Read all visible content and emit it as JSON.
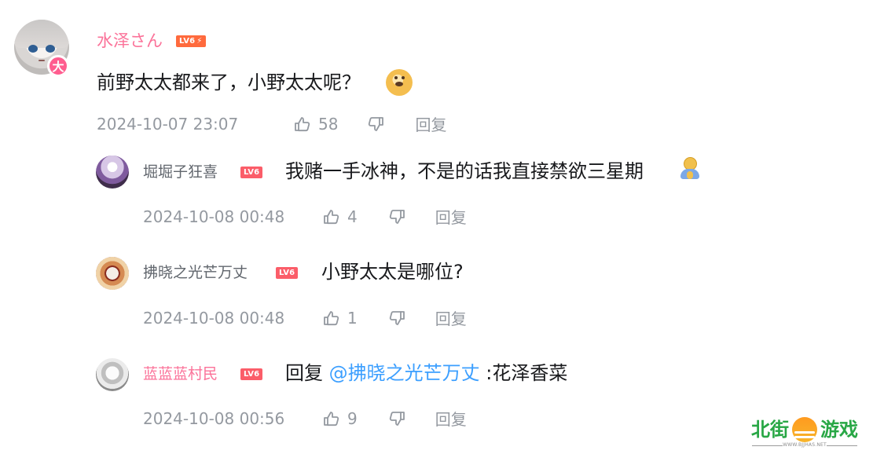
{
  "comments": [
    {
      "username": "水泽さん",
      "level": "LV6",
      "level_bolt": "⚡",
      "avatar_badge": "大",
      "text": "前野太太都来了，小野太太呢？",
      "date": "2024-10-07 23:07",
      "likes": "58",
      "reply_label": "回复"
    },
    {
      "username": "堀堀子狂喜",
      "level": "LV6",
      "text": "我赌一手冰神，不是的话我直接禁欲三星期",
      "date": "2024-10-08 00:48",
      "likes": "4",
      "reply_label": "回复"
    },
    {
      "username": "拂晓之光芒万丈",
      "level": "LV6",
      "text": "小野太太是哪位?",
      "date": "2024-10-08 00:48",
      "likes": "1",
      "reply_label": "回复"
    },
    {
      "username": "蓝蓝蓝村民",
      "level": "LV6",
      "reply_prefix": "回复",
      "mention": "@拂晓之光芒万丈",
      "text_after_mention": ":花泽香菜",
      "date": "2024-10-08 00:56",
      "likes": "9",
      "reply_label": "回复"
    }
  ],
  "icons": {
    "like": "thumb-up-icon",
    "dislike": "thumb-down-icon",
    "dog_emoji": "dog-emoji-icon",
    "pray_emoji": "pray-emoji-icon"
  },
  "watermark": {
    "text_left": "北街",
    "text_right": "游戏",
    "url": "WWW.BJJHAS.NET"
  },
  "colors": {
    "pink_username": "#fb7299",
    "gray_meta": "#9499a0",
    "mention_blue": "#3c9fff",
    "level_badge": "#ff6a3d"
  }
}
